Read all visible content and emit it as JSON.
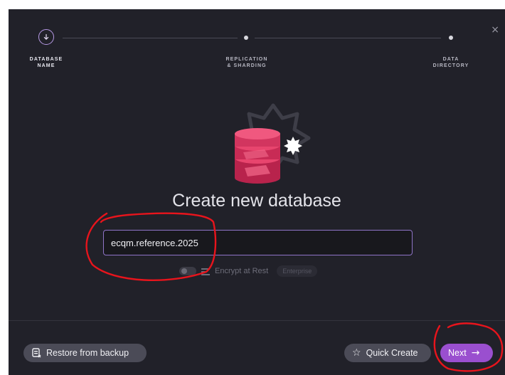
{
  "stepper": {
    "steps": [
      {
        "label": "DATABASE\nNAME",
        "state": "active",
        "icon": "arrow-down-icon"
      },
      {
        "label": "REPLICATION\n& SHARDING",
        "state": "pending"
      },
      {
        "label": "DATA\nDIRECTORY",
        "state": "pending"
      }
    ]
  },
  "dialog": {
    "close_icon": "×",
    "title": "Create new database",
    "database_name": "ecqm.reference.2025",
    "encrypt_label": "Encrypt at Rest",
    "encrypt_enabled": false,
    "enterprise_badge": "Enterprise"
  },
  "footer": {
    "restore_label": "Restore from backup",
    "quick_create_label": "Quick Create",
    "next_label": "Next"
  },
  "colors": {
    "background": "#212129",
    "accent": "#9a4fcf",
    "database_icon": "#e8456e",
    "annotation": "#e8141c"
  }
}
